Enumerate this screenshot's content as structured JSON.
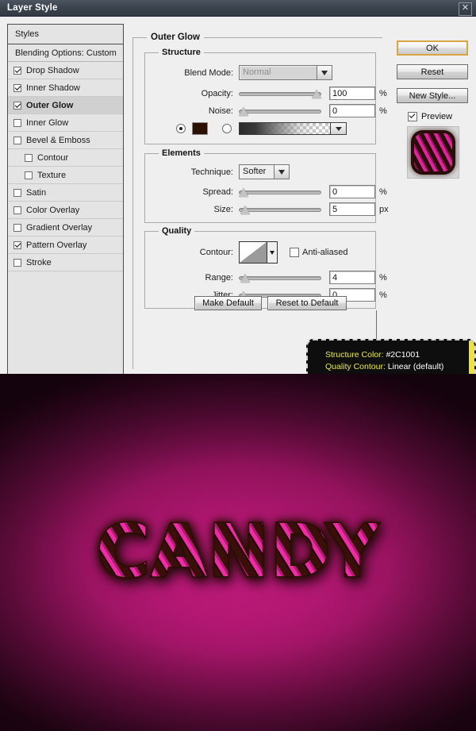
{
  "window": {
    "title": "Layer Style",
    "close_label": "✕"
  },
  "styles_panel": {
    "header": "Styles",
    "blending_options": "Blending Options: Custom",
    "items": [
      {
        "label": "Drop Shadow",
        "checked": true,
        "indent": false,
        "selected": false
      },
      {
        "label": "Inner Shadow",
        "checked": true,
        "indent": false,
        "selected": false
      },
      {
        "label": "Outer Glow",
        "checked": true,
        "indent": false,
        "selected": true
      },
      {
        "label": "Inner Glow",
        "checked": false,
        "indent": false,
        "selected": false
      },
      {
        "label": "Bevel & Emboss",
        "checked": false,
        "indent": false,
        "selected": false
      },
      {
        "label": "Contour",
        "checked": false,
        "indent": true,
        "selected": false
      },
      {
        "label": "Texture",
        "checked": false,
        "indent": true,
        "selected": false
      },
      {
        "label": "Satin",
        "checked": false,
        "indent": false,
        "selected": false
      },
      {
        "label": "Color Overlay",
        "checked": false,
        "indent": false,
        "selected": false
      },
      {
        "label": "Gradient Overlay",
        "checked": false,
        "indent": false,
        "selected": false
      },
      {
        "label": "Pattern Overlay",
        "checked": true,
        "indent": false,
        "selected": false
      },
      {
        "label": "Stroke",
        "checked": false,
        "indent": false,
        "selected": false
      }
    ]
  },
  "panel": {
    "title": "Outer Glow",
    "structure": {
      "title": "Structure",
      "blend_mode_label": "Blend Mode:",
      "blend_mode_value": "Normal",
      "opacity_label": "Opacity:",
      "opacity_value": "100",
      "opacity_unit": "%",
      "noise_label": "Noise:",
      "noise_value": "0",
      "noise_unit": "%",
      "color_swatch": "#2C1001",
      "color_radio_selected": true,
      "gradient_radio_selected": false
    },
    "elements": {
      "title": "Elements",
      "technique_label": "Technique:",
      "technique_value": "Softer",
      "spread_label": "Spread:",
      "spread_value": "0",
      "spread_unit": "%",
      "size_label": "Size:",
      "size_value": "5",
      "size_unit": "px"
    },
    "quality": {
      "title": "Quality",
      "contour_label": "Contour:",
      "contour_value": "Linear",
      "antialiased_label": "Anti-aliased",
      "antialiased_checked": false,
      "range_label": "Range:",
      "range_value": "4",
      "range_unit": "%",
      "jitter_label": "Jitter:",
      "jitter_value": "0",
      "jitter_unit": "%"
    },
    "buttons": {
      "make_default": "Make Default",
      "reset_to_default": "Reset to Default"
    }
  },
  "side": {
    "ok": "OK",
    "reset": "Reset",
    "new_style": "New Style...",
    "preview_label": "Preview",
    "preview_checked": true
  },
  "tooltip": {
    "line1_key": "Structure Color:",
    "line1_value": "#2C1001",
    "line2_key": "Quality Contour:",
    "line2_value": "Linear (default)",
    "accent_color": "#ECE43A"
  },
  "artwork": {
    "word": "CANDY",
    "background_color": "#8E1159",
    "highlight_color": "#C21A7D",
    "stripe_pink": "#EF2BA6",
    "stripe_dark": "#2C1001"
  }
}
